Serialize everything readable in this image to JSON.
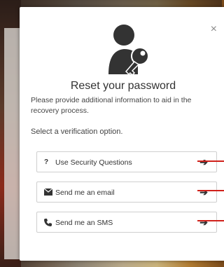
{
  "dialog": {
    "close_label": "×",
    "title": "Reset your password",
    "description": "Please provide additional information to aid in the recovery process.",
    "subheading": "Select a verification option.",
    "options": [
      {
        "icon": "question-icon",
        "icon_glyph": "?",
        "label": "Use Security Questions",
        "arrow": "➔"
      },
      {
        "icon": "envelope-icon",
        "icon_glyph": "",
        "label": "Send me an email",
        "arrow": "➔"
      },
      {
        "icon": "phone-icon",
        "icon_glyph": "",
        "label": "Send me an SMS",
        "arrow": "➔"
      }
    ]
  },
  "colors": {
    "icon": "#333333",
    "annotation_red": "#d0201a"
  }
}
